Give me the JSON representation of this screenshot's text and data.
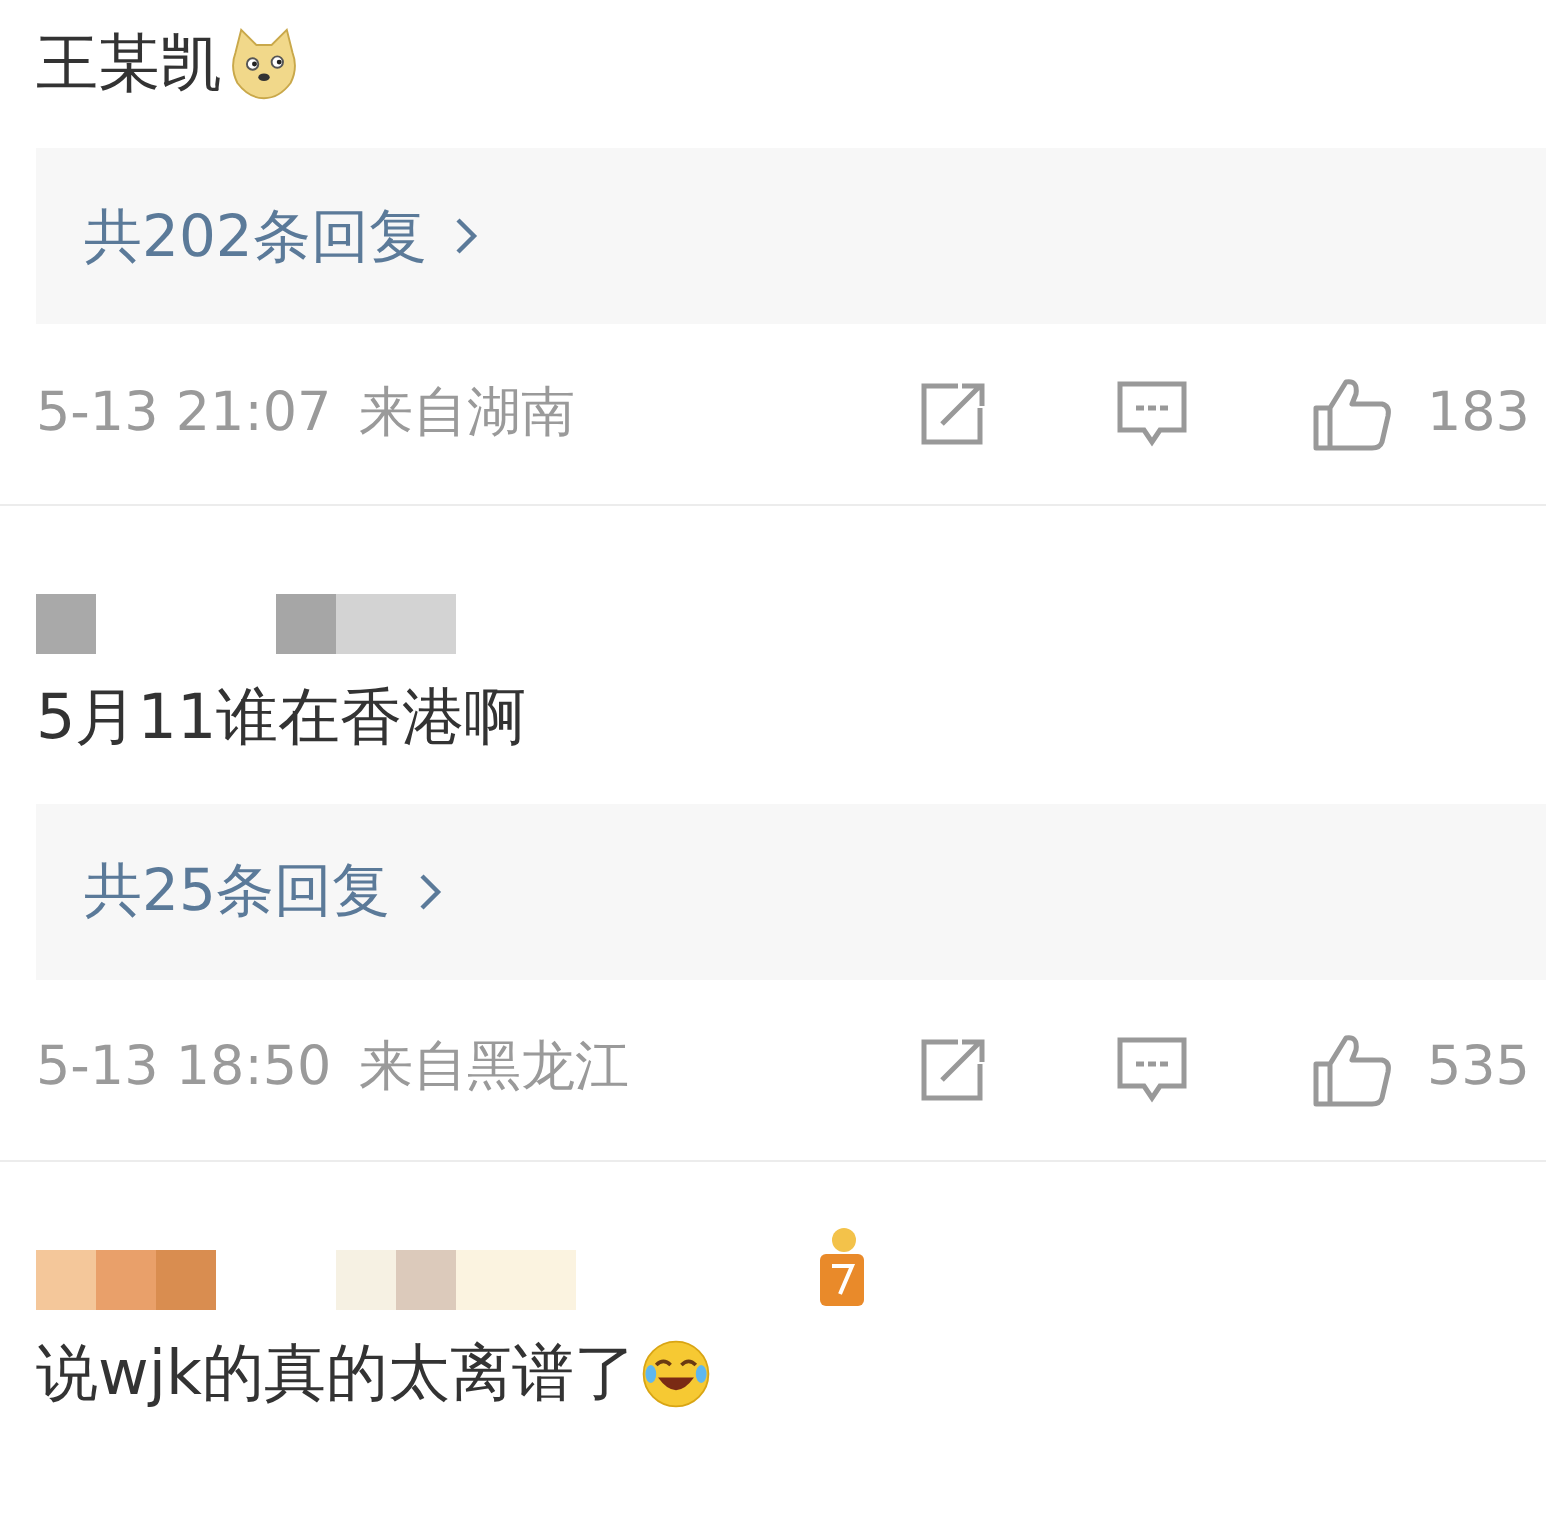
{
  "comments": [
    {
      "text": "王某凯",
      "emoji": {
        "kind": "doge"
      },
      "replies": "共202条回复",
      "time": "5-13 21:07",
      "location": "来自湖南",
      "likes": "183"
    },
    {
      "name_block": {
        "kind": "gray"
      },
      "text": "5月11谁在香港啊",
      "replies": "共25条回复",
      "time": "5-13 18:50",
      "location": "来自黑龙江",
      "likes": "535"
    },
    {
      "name_block": {
        "kind": "warm"
      },
      "text": "说wjk的真的太离谱了",
      "emoji": {
        "kind": "laugh"
      }
    }
  ]
}
